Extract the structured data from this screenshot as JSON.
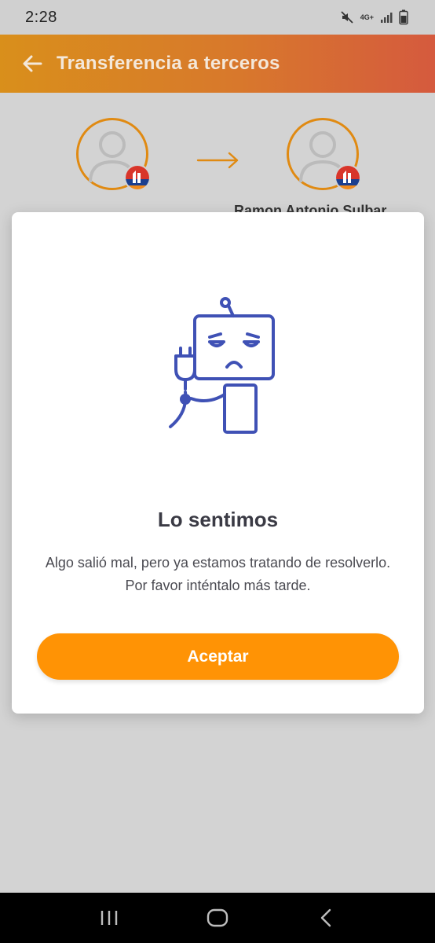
{
  "status_bar": {
    "time": "2:28",
    "network": "4G+",
    "icons": [
      "mute-icon",
      "signal-icon",
      "battery-icon"
    ]
  },
  "header": {
    "title": "Transferencia a terceros",
    "back_icon": "arrow-left-icon",
    "gradient": [
      "#d98f1b",
      "#d55a3e"
    ]
  },
  "transfer": {
    "recipient_name": "Ramon Antonio Sulbar",
    "accent_color": "#e08a12"
  },
  "error_dialog": {
    "illustration": "robot-unplugged-icon",
    "title": "Lo sentimos",
    "message": "Algo salió mal, pero ya estamos tratando de resolverlo. Por favor inténtalo más tarde.",
    "accept_label": "Aceptar",
    "button_color": "#ff9305"
  },
  "nav_bar": {
    "buttons": [
      "recents-icon",
      "home-icon",
      "back-icon"
    ]
  }
}
